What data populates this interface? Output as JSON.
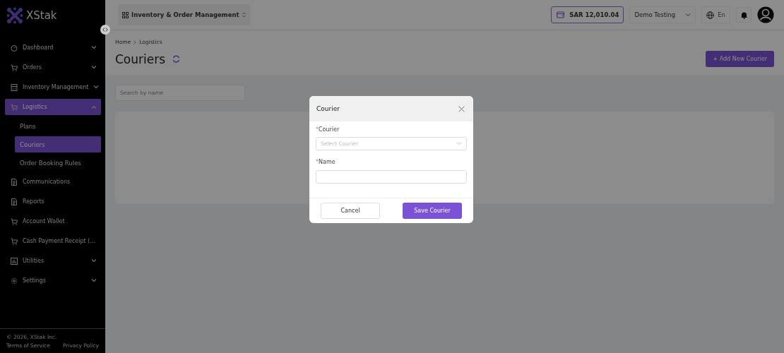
{
  "logo": {
    "text": "XStak"
  },
  "sidebar": {
    "items": [
      {
        "label": "Dashboard",
        "kind": "group",
        "expanded": false,
        "selected": false
      },
      {
        "label": "Orders",
        "kind": "group",
        "expanded": false,
        "selected": false
      },
      {
        "label": "Inventory Management",
        "kind": "group",
        "expanded": false,
        "selected": false
      },
      {
        "label": "Logistics",
        "kind": "group",
        "expanded": true,
        "selected": true,
        "children": [
          {
            "label": "Plans",
            "selected": false
          },
          {
            "label": "Couriers",
            "selected": true
          },
          {
            "label": "Order Booking Rules",
            "selected": false
          }
        ]
      },
      {
        "label": "Communications",
        "kind": "link",
        "selected": false
      },
      {
        "label": "Reports",
        "kind": "link",
        "selected": false
      },
      {
        "label": "Account Wallet",
        "kind": "link",
        "selected": false
      },
      {
        "label": "Cash Payment Receipt (...",
        "kind": "link",
        "selected": false
      },
      {
        "label": "Utilities",
        "kind": "group",
        "expanded": false,
        "selected": false
      },
      {
        "label": "Settings",
        "kind": "group",
        "expanded": false,
        "selected": false
      }
    ],
    "footer": {
      "copyright": "© 2026, XStak Inc.",
      "links": [
        "Terms of Service",
        "Privacy Policy"
      ]
    }
  },
  "header": {
    "app_switcher": "Inventory & Order Management",
    "wallet": "SAR 12,010.04",
    "account": "Demo Testing",
    "language": "En"
  },
  "breadcrumb": [
    "Home",
    "Logistics"
  ],
  "page": {
    "title": "Couriers",
    "add_button": "+ Add New Courier",
    "search": {
      "placeholder": "Search by name"
    }
  },
  "modal": {
    "title": "Courier",
    "required_mark": "*",
    "fields": [
      {
        "label": "Courier",
        "kind": "select",
        "required": true,
        "placeholder": "Select Courier"
      },
      {
        "label": "Name",
        "kind": "text",
        "required": true
      }
    ],
    "buttons": [
      {
        "label": "Cancel",
        "kind": "secondary"
      },
      {
        "label": "Save Courier",
        "kind": "primary"
      }
    ]
  }
}
